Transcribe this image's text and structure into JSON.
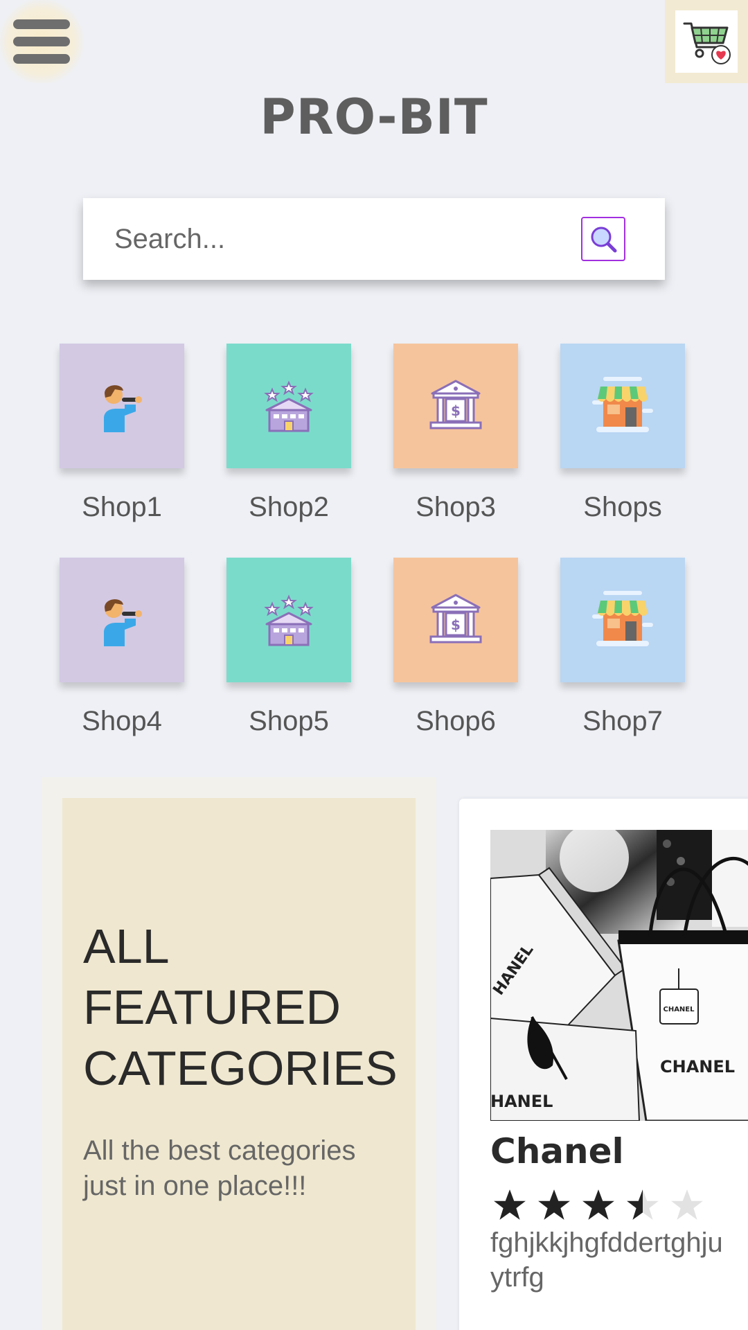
{
  "header": {
    "menu_icon": "hamburger-menu-icon",
    "cart_icon": "shopping-cart-heart-icon",
    "brand": "PRO-BIT"
  },
  "search": {
    "placeholder": "Search...",
    "value": "",
    "button_icon": "magnifier-search-icon",
    "accent": "#a12fe0"
  },
  "shops": [
    {
      "label": "Shop1",
      "icon": "singer-icon",
      "color": "#d3c9e3"
    },
    {
      "label": "Shop2",
      "icon": "hotel-stars-icon",
      "color": "#7bdbcb"
    },
    {
      "label": "Shop3",
      "icon": "bank-dollar-icon",
      "color": "#f6c49c"
    },
    {
      "label": "Shops",
      "icon": "storefront-icon",
      "color": "#b9d6f3"
    },
    {
      "label": "Shop4",
      "icon": "singer-icon",
      "color": "#d3c9e3"
    },
    {
      "label": "Shop5",
      "icon": "hotel-stars-icon",
      "color": "#7bdbcb"
    },
    {
      "label": "Shop6",
      "icon": "bank-dollar-icon",
      "color": "#f6c49c"
    },
    {
      "label": "Shop7",
      "icon": "storefront-icon",
      "color": "#b9d6f3"
    }
  ],
  "featured": {
    "title_lines": [
      "ALL",
      "FEATURED",
      "CATEGORIES"
    ],
    "subtitle_lines": [
      "All the best categories",
      "just in one place!!!"
    ]
  },
  "product": {
    "name": "Chanel",
    "rating": 3.5,
    "rating_max": 5,
    "description_lines": [
      "fghjkkjhgfddertghju",
      "ytrfg"
    ],
    "bag_labels": [
      "HANEL",
      "CHANEL",
      "CHANEL",
      "HANEL"
    ]
  }
}
